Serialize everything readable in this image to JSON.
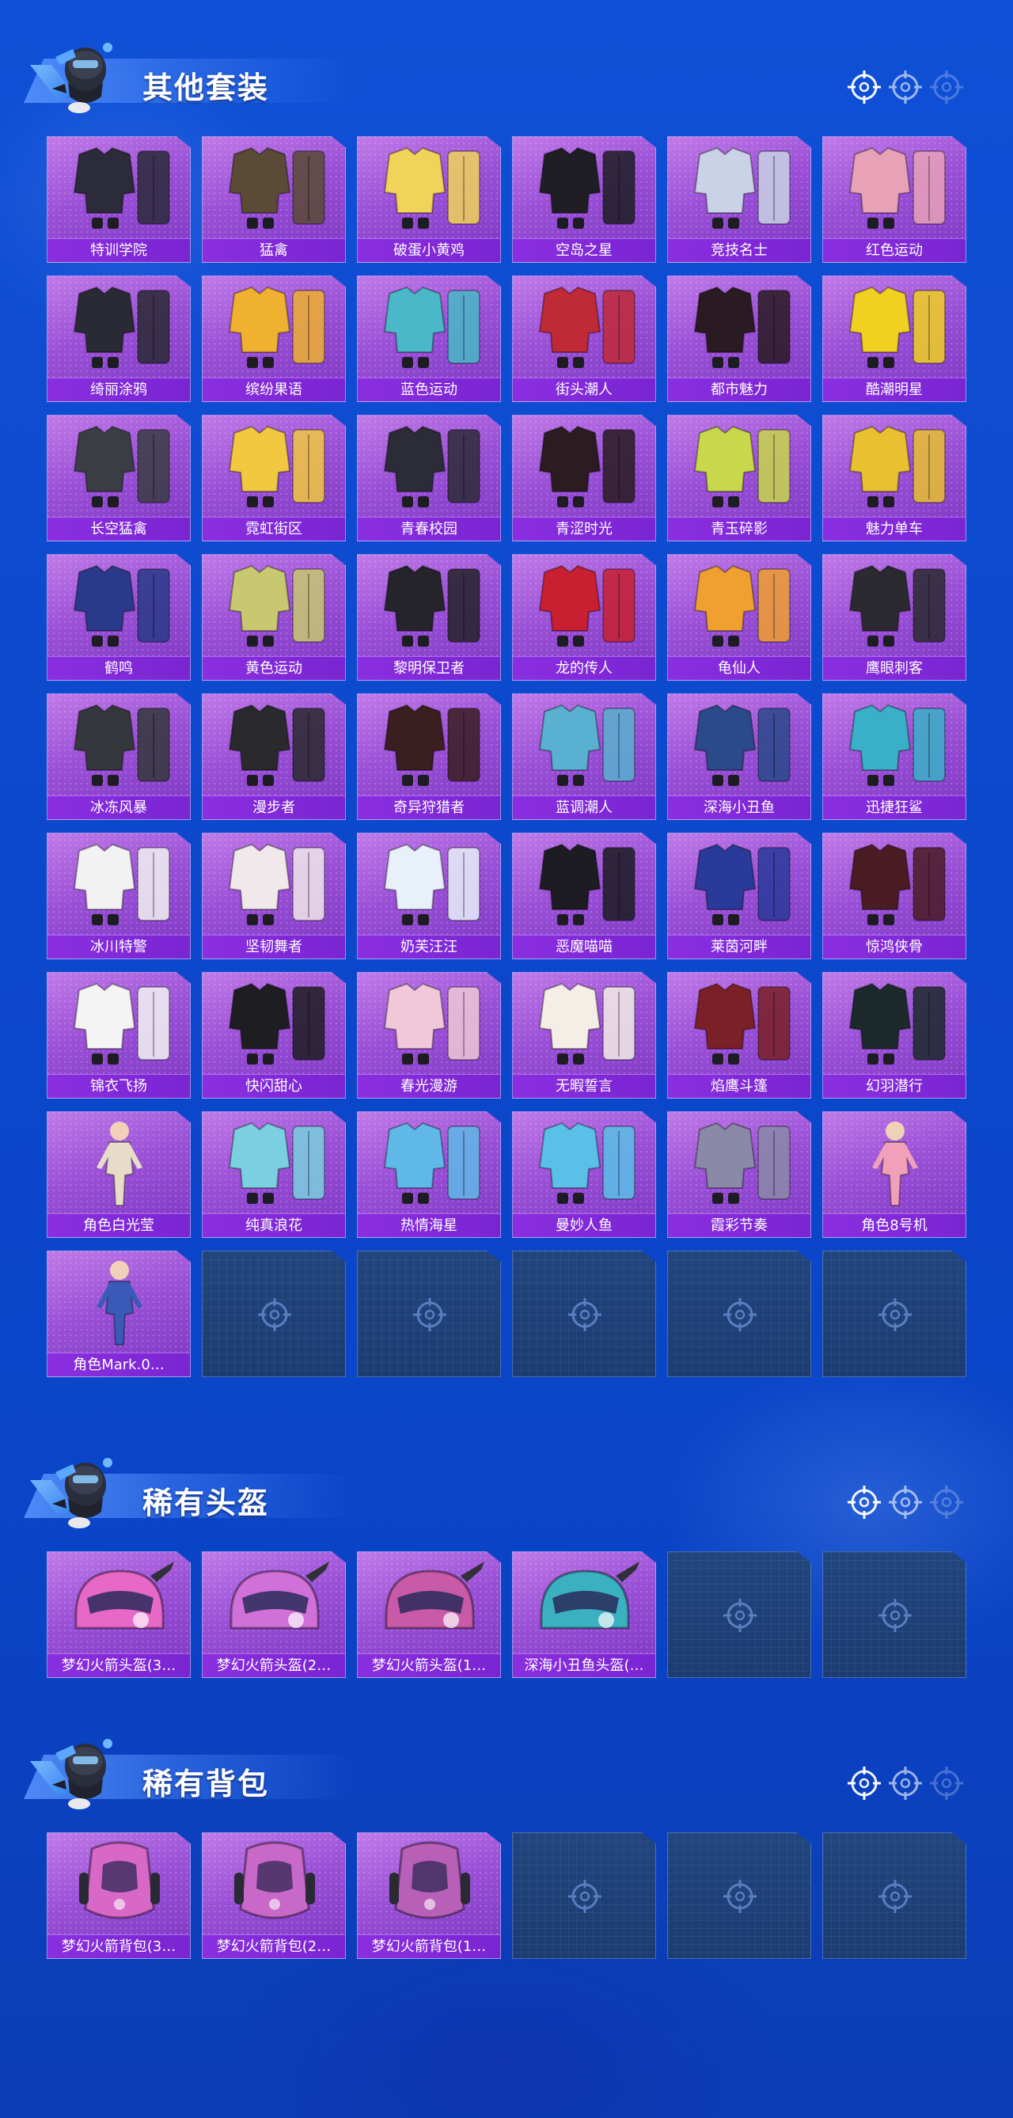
{
  "colors": {
    "background": "#0c48cc",
    "tile_purple": "#9a50d6",
    "label_purple": "#7a24d2",
    "empty_tile": "#1f4178",
    "title_text": "#ffffff"
  },
  "sections": [
    {
      "title": "其他套装",
      "mascot_icon": "mascot-icon",
      "items": [
        {
          "label": "特训学院",
          "icon": "outfit-icon",
          "tint": "#2b2b3a"
        },
        {
          "label": "猛禽",
          "icon": "outfit-icon",
          "tint": "#5a4a36"
        },
        {
          "label": "破蛋小黄鸡",
          "icon": "outfit-icon",
          "tint": "#f2d35a"
        },
        {
          "label": "空岛之星",
          "icon": "outfit-icon",
          "tint": "#1e1e24"
        },
        {
          "label": "竞技名士",
          "icon": "outfit-icon",
          "tint": "#c9d2e6"
        },
        {
          "label": "红色运动",
          "icon": "outfit-icon",
          "tint": "#e8a2b8"
        },
        {
          "label": "绮丽涂鸦",
          "icon": "outfit-icon",
          "tint": "#2a2a34"
        },
        {
          "label": "缤纷果语",
          "icon": "outfit-icon",
          "tint": "#f0b030"
        },
        {
          "label": "蓝色运动",
          "icon": "outfit-icon",
          "tint": "#4ab8c8"
        },
        {
          "label": "街头潮人",
          "icon": "outfit-icon",
          "tint": "#c02a36"
        },
        {
          "label": "都市魅力",
          "icon": "outfit-icon",
          "tint": "#2a1a22"
        },
        {
          "label": "酷潮明星",
          "icon": "outfit-icon",
          "tint": "#f0d020"
        },
        {
          "label": "长空猛禽",
          "icon": "outfit-icon",
          "tint": "#3a3e44"
        },
        {
          "label": "霓虹街区",
          "icon": "outfit-icon",
          "tint": "#f2c840"
        },
        {
          "label": "青春校园",
          "icon": "outfit-icon",
          "tint": "#2c2c38"
        },
        {
          "label": "青涩时光",
          "icon": "outfit-icon",
          "tint": "#2a1c20"
        },
        {
          "label": "青玉碎影",
          "icon": "outfit-icon",
          "tint": "#c8d84a"
        },
        {
          "label": "魅力单车",
          "icon": "outfit-icon",
          "tint": "#e8c030"
        },
        {
          "label": "鹤鸣",
          "icon": "outfit-icon",
          "tint": "#2a3a8a"
        },
        {
          "label": "黄色运动",
          "icon": "outfit-icon",
          "tint": "#c8c870"
        },
        {
          "label": "黎明保卫者",
          "icon": "outfit-icon",
          "tint": "#24242a"
        },
        {
          "label": "龙的传人",
          "icon": "outfit-icon",
          "tint": "#c82030"
        },
        {
          "label": "龟仙人",
          "icon": "outfit-icon",
          "tint": "#f0a030"
        },
        {
          "label": "鹰眼刺客",
          "icon": "outfit-icon",
          "tint": "#2a2a30"
        },
        {
          "label": "冰冻风暴",
          "icon": "outfit-icon",
          "tint": "#34383c"
        },
        {
          "label": "漫步者",
          "icon": "outfit-icon",
          "tint": "#2a2a2e"
        },
        {
          "label": "奇异狩猎者",
          "icon": "outfit-icon",
          "tint": "#3a1e20"
        },
        {
          "label": "蓝调潮人",
          "icon": "outfit-icon",
          "tint": "#5ab0d0"
        },
        {
          "label": "深海小丑鱼",
          "icon": "outfit-icon",
          "tint": "#2a4a8a"
        },
        {
          "label": "迅捷狂鲨",
          "icon": "outfit-icon",
          "tint": "#3ab0c8"
        },
        {
          "label": "冰川特警",
          "icon": "outfit-icon",
          "tint": "#f2f2f2"
        },
        {
          "label": "坚韧舞者",
          "icon": "outfit-icon",
          "tint": "#f0e8ea"
        },
        {
          "label": "奶芙汪汪",
          "icon": "outfit-icon",
          "tint": "#e8f0fa"
        },
        {
          "label": "恶魔喵喵",
          "icon": "outfit-icon",
          "tint": "#1c1c22"
        },
        {
          "label": "莱茵河畔",
          "icon": "outfit-icon",
          "tint": "#2a3a9a"
        },
        {
          "label": "惊鸿侠骨",
          "icon": "outfit-icon",
          "tint": "#4a1c24"
        },
        {
          "label": "锦衣飞扬",
          "icon": "outfit-icon",
          "tint": "#f4f4f4"
        },
        {
          "label": "快闪甜心",
          "icon": "outfit-icon",
          "tint": "#1e1e22"
        },
        {
          "label": "春光漫游",
          "icon": "outfit-icon",
          "tint": "#f0c8d8"
        },
        {
          "label": "无暇誓言",
          "icon": "outfit-icon",
          "tint": "#f4eee6"
        },
        {
          "label": "焰鹰斗篷",
          "icon": "outfit-icon",
          "tint": "#7a2026"
        },
        {
          "label": "幻羽潜行",
          "icon": "outfit-icon",
          "tint": "#1c2a2c"
        },
        {
          "label": "角色白光莹",
          "icon": "character-icon",
          "tint": "#e8dcc8"
        },
        {
          "label": "纯真浪花",
          "icon": "outfit-icon",
          "tint": "#7ad0e0"
        },
        {
          "label": "热情海星",
          "icon": "outfit-icon",
          "tint": "#60b8e8"
        },
        {
          "label": "曼妙人鱼",
          "icon": "outfit-icon",
          "tint": "#5ac0e8"
        },
        {
          "label": "霞彩节奏",
          "icon": "outfit-icon",
          "tint": "#8a8aa8"
        },
        {
          "label": "角色8号机",
          "icon": "character-icon",
          "tint": "#f0a0b8"
        },
        {
          "label": "角色Mark.0…",
          "icon": "character-icon",
          "tint": "#3a5ab8"
        }
      ],
      "empty_slots": 5
    },
    {
      "title": "稀有头盔",
      "mascot_icon": "mascot-icon",
      "items": [
        {
          "label": "梦幻火箭头盔(3…",
          "icon": "helmet-icon",
          "tint": "#e868c8"
        },
        {
          "label": "梦幻火箭头盔(2…",
          "icon": "helmet-icon",
          "tint": "#d070d8"
        },
        {
          "label": "梦幻火箭头盔(1…",
          "icon": "helmet-icon",
          "tint": "#c85aa8"
        },
        {
          "label": "深海小丑鱼头盔(…",
          "icon": "helmet-icon",
          "tint": "#3ab0c0"
        }
      ],
      "empty_slots": 2
    },
    {
      "title": "稀有背包",
      "mascot_icon": "mascot-icon",
      "items": [
        {
          "label": "梦幻火箭背包(3…",
          "icon": "backpack-icon",
          "tint": "#d868c8"
        },
        {
          "label": "梦幻火箭背包(2…",
          "icon": "backpack-icon",
          "tint": "#c868c8"
        },
        {
          "label": "梦幻火箭背包(1…",
          "icon": "backpack-icon",
          "tint": "#b860b8"
        }
      ],
      "empty_slots": 3
    }
  ]
}
